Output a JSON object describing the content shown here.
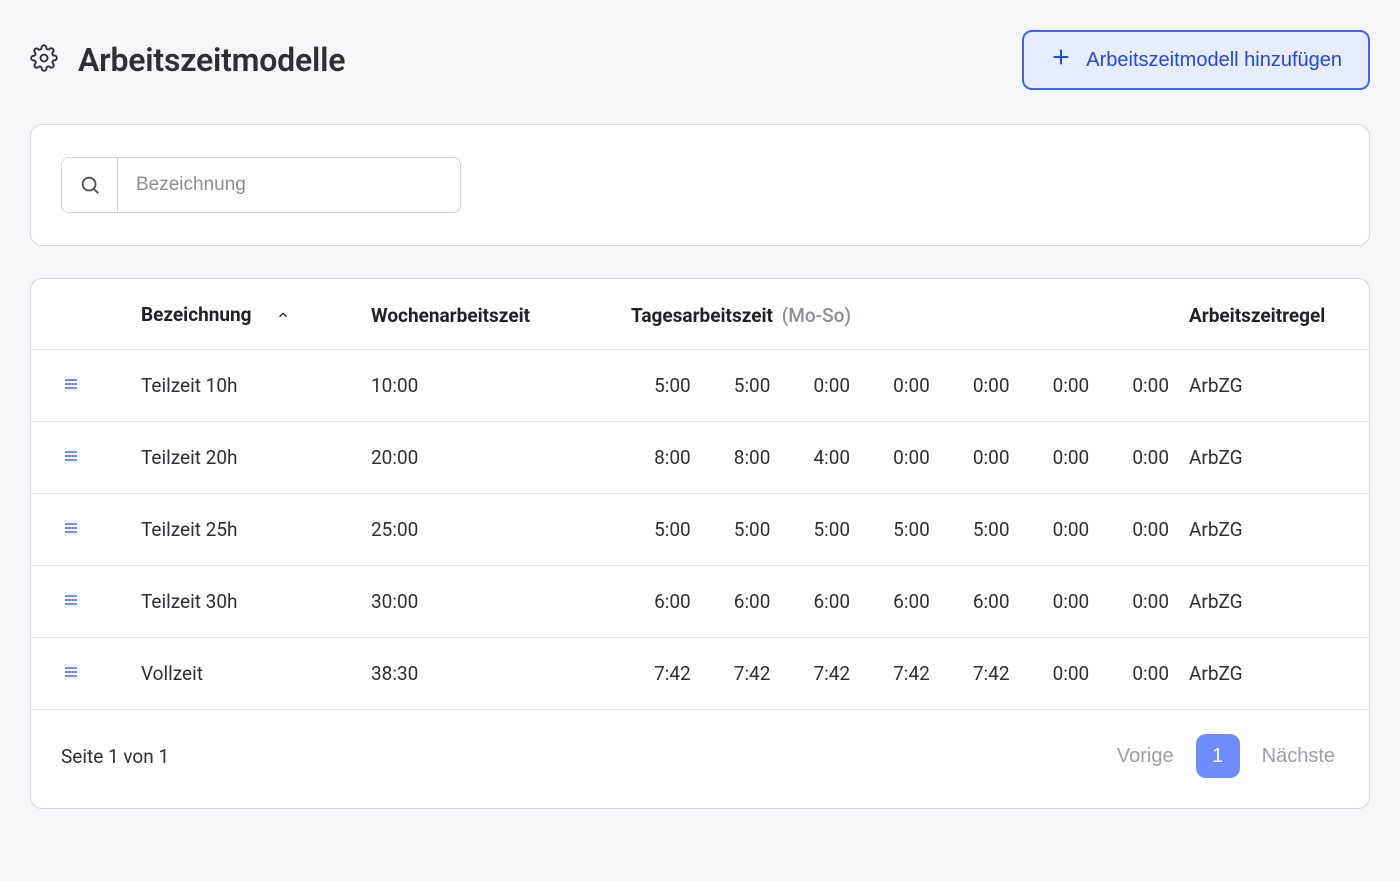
{
  "header": {
    "title": "Arbeitszeitmodelle",
    "add_button_label": "Arbeitszeitmodell hinzufügen"
  },
  "search": {
    "placeholder": "Bezeichnung",
    "value": ""
  },
  "table": {
    "columns": {
      "name": "Bezeichnung",
      "week": "Wochenarbeitszeit",
      "day": "Tagesarbeitszeit",
      "day_suffix": "(Mo-So)",
      "rule": "Arbeitszeitregel"
    },
    "sort": {
      "column": "name",
      "direction": "asc"
    },
    "rows": [
      {
        "name": "Teilzeit 10h",
        "week": "10:00",
        "days": [
          "5:00",
          "5:00",
          "0:00",
          "0:00",
          "0:00",
          "0:00",
          "0:00"
        ],
        "rule": "ArbZG"
      },
      {
        "name": "Teilzeit 20h",
        "week": "20:00",
        "days": [
          "8:00",
          "8:00",
          "4:00",
          "0:00",
          "0:00",
          "0:00",
          "0:00"
        ],
        "rule": "ArbZG"
      },
      {
        "name": "Teilzeit 25h",
        "week": "25:00",
        "days": [
          "5:00",
          "5:00",
          "5:00",
          "5:00",
          "5:00",
          "0:00",
          "0:00"
        ],
        "rule": "ArbZG"
      },
      {
        "name": "Teilzeit 30h",
        "week": "30:00",
        "days": [
          "6:00",
          "6:00",
          "6:00",
          "6:00",
          "6:00",
          "0:00",
          "0:00"
        ],
        "rule": "ArbZG"
      },
      {
        "name": "Vollzeit",
        "week": "38:30",
        "days": [
          "7:42",
          "7:42",
          "7:42",
          "7:42",
          "7:42",
          "0:00",
          "0:00"
        ],
        "rule": "ArbZG"
      }
    ]
  },
  "pagination": {
    "status": "Seite 1 von 1",
    "prev_label": "Vorige",
    "next_label": "Nächste",
    "current_page": "1"
  }
}
